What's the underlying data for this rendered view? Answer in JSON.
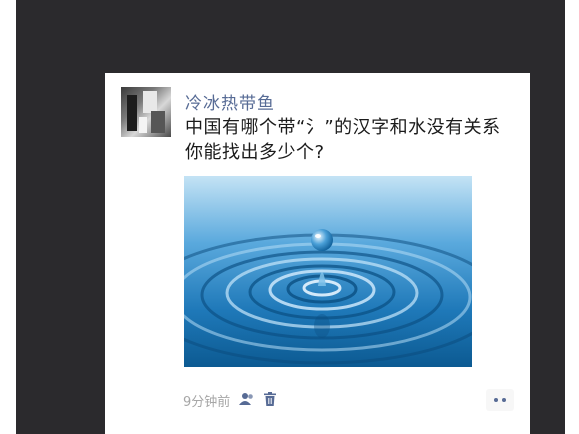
{
  "post": {
    "username": "冷冰热带鱼",
    "text_line1": "中国有哪个带“氵”的汉字和水没有关系",
    "text_line2": "你能找出多少个?",
    "image_subject": "water-droplet-ripples",
    "time": "9分钟前",
    "privacy_icon": "friends-visible-icon",
    "delete_icon": "trash-icon",
    "more_icon": "more-options-icon"
  },
  "colors": {
    "background": "#2b2a2d",
    "username": "#576b95",
    "text": "#1b1b1b",
    "meta": "#a6a6a6",
    "water_light": "#b9ddf3",
    "water_dark": "#0d5e97"
  }
}
